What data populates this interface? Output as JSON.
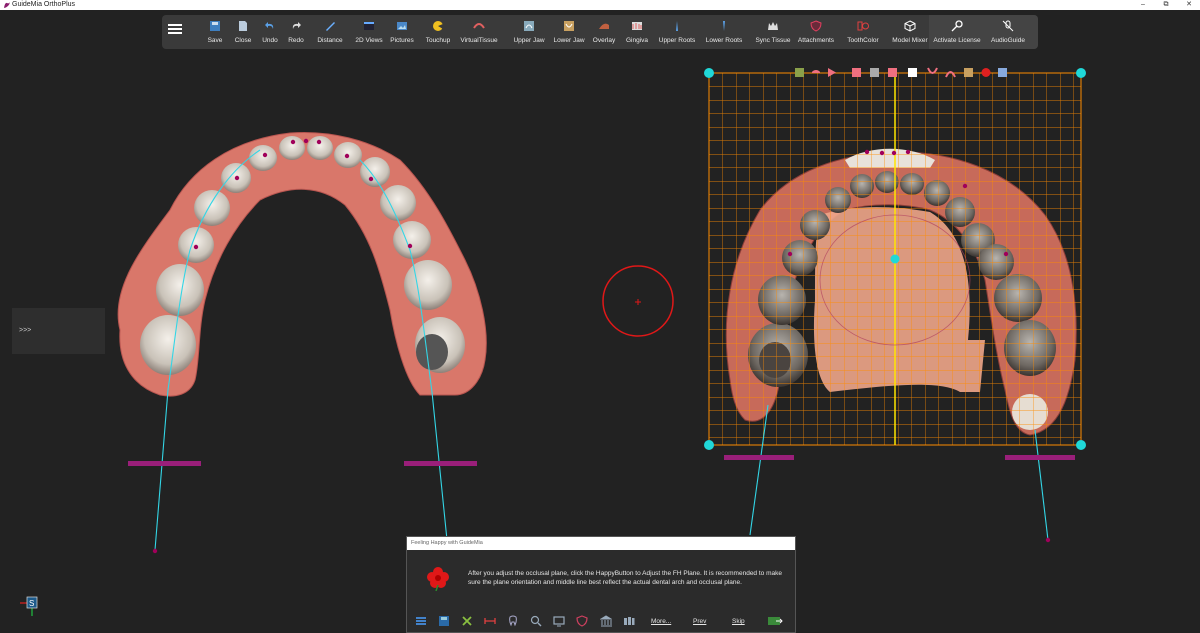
{
  "window": {
    "title": "GuideMia OrthoPlus",
    "minimize": "–",
    "maximize": "⧉",
    "close": "✕"
  },
  "toolbar": {
    "items": [
      {
        "label": "Save",
        "icon": "save-icon"
      },
      {
        "label": "Close",
        "icon": "close-file-icon"
      },
      {
        "label": "Undo",
        "icon": "undo-icon"
      },
      {
        "label": "Redo",
        "icon": "redo-icon"
      },
      {
        "label": "Distance",
        "icon": "ruler-icon"
      },
      {
        "label": "2D Views",
        "icon": "2d-views-icon"
      },
      {
        "label": "Pictures",
        "icon": "pictures-icon"
      },
      {
        "label": "Touchup",
        "icon": "touchup-icon"
      },
      {
        "label": "VirtualTissue",
        "icon": "virtual-tissue-icon"
      },
      {
        "label": "Upper Jaw",
        "icon": "upper-jaw-icon"
      },
      {
        "label": "Lower Jaw",
        "icon": "lower-jaw-icon"
      },
      {
        "label": "Overlay",
        "icon": "overlay-icon"
      },
      {
        "label": "Gingiva",
        "icon": "gingiva-icon"
      },
      {
        "label": "Upper Roots",
        "icon": "upper-roots-icon"
      },
      {
        "label": "Lower Roots",
        "icon": "lower-roots-icon"
      },
      {
        "label": "Sync Tissue",
        "icon": "sync-tissue-icon"
      },
      {
        "label": "Attachments",
        "icon": "attachments-icon"
      },
      {
        "label": "ToothColor",
        "icon": "tooth-color-icon"
      },
      {
        "label": "Model Mixer",
        "icon": "model-mixer-icon"
      },
      {
        "label": "Activate License",
        "icon": "key-icon"
      },
      {
        "label": "AudioGuide",
        "icon": "microphone-off-icon"
      }
    ]
  },
  "side_panel": {
    "toggle_label": ">>>"
  },
  "dialog": {
    "title": "Feeling Happy with GuideMia",
    "message": "After you adjust the occlusal plane, click the HappyButton to Adjust the FH Plane. It is recommended to make sure the plane orientation and middle line best reflect the actual dental arch and occlusal plane.",
    "more_label": "More...",
    "prev_label": "Prev",
    "skip_label": "Skip"
  },
  "colors": {
    "background": "#222222",
    "toolbar": "#3a3a3a",
    "guide_line": "#33d6e6",
    "landmark": "#a0005a",
    "grid": "#ff8c00",
    "midline": "#ffe600",
    "handle": "#20d8d8",
    "target": "#e01818"
  }
}
